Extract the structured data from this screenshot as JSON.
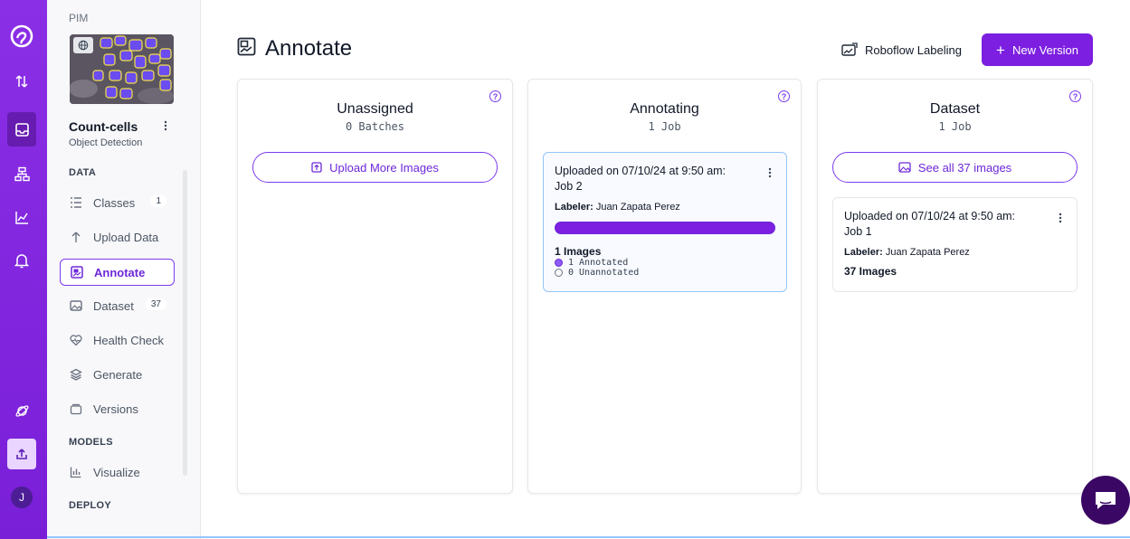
{
  "rail": {
    "items": [
      "logo-icon",
      "transfer-icon",
      "inbox-icon",
      "hierarchy-icon",
      "analytics-icon",
      "bell-icon",
      "planet-icon",
      "upload-icon"
    ],
    "avatar_initial": "J",
    "colors": {
      "rail_bg": "#8b2fe6",
      "accent": "#7c1fe0"
    }
  },
  "sidebar": {
    "project_code": "PIM",
    "project_name": "Count-cells",
    "project_type": "Object Detection",
    "sections": {
      "data": "DATA",
      "models": "MODELS",
      "deploy": "DEPLOY"
    },
    "items": [
      {
        "label": "Classes",
        "badge": "1",
        "icon": "list-icon"
      },
      {
        "label": "Upload Data",
        "badge": "",
        "icon": "arrow-up-icon"
      },
      {
        "label": "Annotate",
        "badge": "",
        "icon": "annotate-icon",
        "active": true
      },
      {
        "label": "Dataset",
        "badge": "37",
        "icon": "image-icon"
      },
      {
        "label": "Health Check",
        "badge": "",
        "icon": "heart-pulse-icon"
      },
      {
        "label": "Generate",
        "badge": "",
        "icon": "layers-icon"
      },
      {
        "label": "Versions",
        "badge": "",
        "icon": "versions-icon"
      },
      {
        "label": "Visualize",
        "badge": "",
        "icon": "chart-icon"
      }
    ]
  },
  "header": {
    "title": "Annotate",
    "labeling_button": "Roboflow Labeling",
    "new_version_button": "New Version"
  },
  "columns": {
    "unassigned": {
      "title": "Unassigned",
      "subtitle": "0 Batches",
      "button": "Upload More Images"
    },
    "annotating": {
      "title": "Annotating",
      "subtitle": "1 Job",
      "job": {
        "title_line1": "Uploaded on 07/10/24 at 9:50 am:",
        "title_line2": "Job 2",
        "labeler_key": "Labeler:",
        "labeler_name": "Juan Zapata Perez",
        "progress": 1.0,
        "images": "1 Images",
        "annotated": "1 Annotated",
        "unannotated": "0 Unannotated"
      }
    },
    "dataset": {
      "title": "Dataset",
      "subtitle": "1 Job",
      "button": "See all 37 images",
      "job": {
        "title_line1": "Uploaded on 07/10/24 at 9:50 am:",
        "title_line2": "Job 1",
        "labeler_key": "Labeler:",
        "labeler_name": "Juan Zapata Perez",
        "images": "37 Images"
      }
    }
  }
}
